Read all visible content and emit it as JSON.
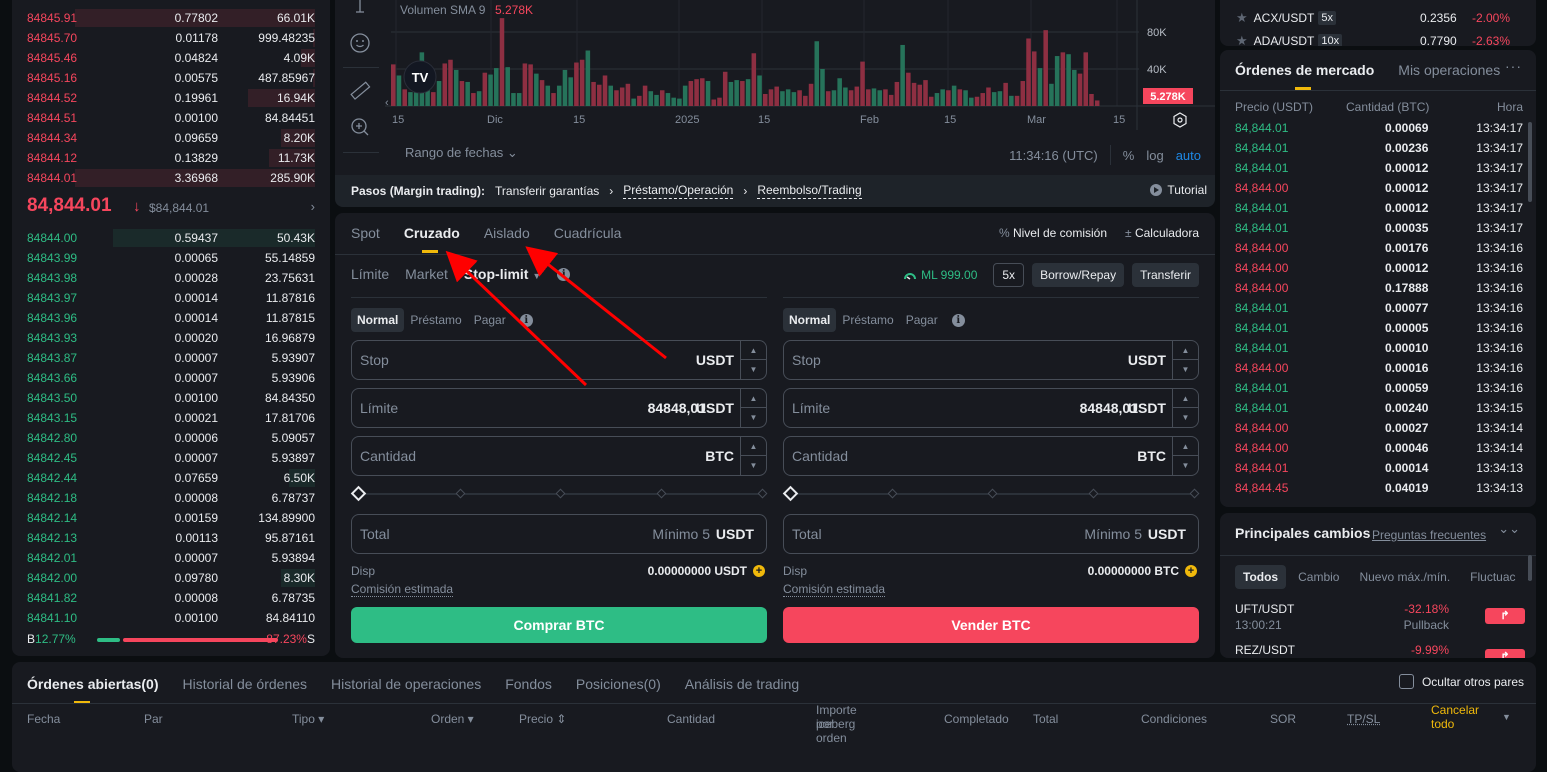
{
  "orderbook": {
    "asks": [
      {
        "price": "84845.91",
        "amount": "0.77802",
        "total": "66.01K",
        "depth": 1.0
      },
      {
        "price": "84845.70",
        "amount": "0.01178",
        "total": "999.48235",
        "depth": 0.01
      },
      {
        "price": "84845.46",
        "amount": "0.04824",
        "total": "4.09K",
        "depth": 0.06
      },
      {
        "price": "84845.16",
        "amount": "0.00575",
        "total": "487.85967",
        "depth": 0.01
      },
      {
        "price": "84844.52",
        "amount": "0.19961",
        "total": "16.94K",
        "depth": 0.28
      },
      {
        "price": "84844.51",
        "amount": "0.00100",
        "total": "84.84451",
        "depth": 0.0
      },
      {
        "price": "84844.34",
        "amount": "0.09659",
        "total": "8.20K",
        "depth": 0.14
      },
      {
        "price": "84844.12",
        "amount": "0.13829",
        "total": "11.73K",
        "depth": 0.19
      },
      {
        "price": "84844.01",
        "amount": "3.36968",
        "total": "285.90K",
        "depth": 1.0
      }
    ],
    "mid_price": "84,844.01",
    "mid_arrow": "↓",
    "mid_usd": "$84,844.01",
    "mid_more": "›",
    "bids": [
      {
        "price": "84844.00",
        "amount": "0.59437",
        "total": "50.43K",
        "depth": 0.84
      },
      {
        "price": "84843.99",
        "amount": "0.00065",
        "total": "55.14859",
        "depth": 0.0
      },
      {
        "price": "84843.98",
        "amount": "0.00028",
        "total": "23.75631",
        "depth": 0.0
      },
      {
        "price": "84843.97",
        "amount": "0.00014",
        "total": "11.87816",
        "depth": 0.0
      },
      {
        "price": "84843.96",
        "amount": "0.00014",
        "total": "11.87815",
        "depth": 0.0
      },
      {
        "price": "84843.93",
        "amount": "0.00020",
        "total": "16.96879",
        "depth": 0.0
      },
      {
        "price": "84843.87",
        "amount": "0.00007",
        "total": "5.93907",
        "depth": 0.0
      },
      {
        "price": "84843.66",
        "amount": "0.00007",
        "total": "5.93906",
        "depth": 0.0
      },
      {
        "price": "84843.50",
        "amount": "0.00100",
        "total": "84.84350",
        "depth": 0.0
      },
      {
        "price": "84843.15",
        "amount": "0.00021",
        "total": "17.81706",
        "depth": 0.0
      },
      {
        "price": "84842.80",
        "amount": "0.00006",
        "total": "5.09057",
        "depth": 0.0
      },
      {
        "price": "84842.45",
        "amount": "0.00007",
        "total": "5.93897",
        "depth": 0.0
      },
      {
        "price": "84842.44",
        "amount": "0.07659",
        "total": "6.50K",
        "depth": 0.11
      },
      {
        "price": "84842.18",
        "amount": "0.00008",
        "total": "6.78737",
        "depth": 0.0
      },
      {
        "price": "84842.14",
        "amount": "0.00159",
        "total": "134.89900",
        "depth": 0.0
      },
      {
        "price": "84842.13",
        "amount": "0.00113",
        "total": "95.87161",
        "depth": 0.0
      },
      {
        "price": "84842.01",
        "amount": "0.00007",
        "total": "5.93894",
        "depth": 0.0
      },
      {
        "price": "84842.00",
        "amount": "0.09780",
        "total": "8.30K",
        "depth": 0.14
      },
      {
        "price": "84841.82",
        "amount": "0.00008",
        "total": "6.78735",
        "depth": 0.0
      },
      {
        "price": "84841.10",
        "amount": "0.00100",
        "total": "84.84110",
        "depth": 0.0
      }
    ],
    "ratio": {
      "b_label": "B",
      "b_pct": "12.77%",
      "s_pct": "87.23%",
      "s_label": "S",
      "buy_fraction": 0.1277
    }
  },
  "chart": {
    "indicator_label": "Volumen SMA 9",
    "indicator_value": "5.278K",
    "y_ticks": [
      "80K",
      "40K"
    ],
    "price_tag": "5.278K",
    "x_ticks": [
      "15",
      "Dic",
      "15",
      "2025",
      "15",
      "Feb",
      "15",
      "Mar",
      "15"
    ],
    "date_range": "Rango de fechas",
    "time": "11:34:16 (UTC)",
    "pct": "%",
    "log": "log",
    "auto": "auto",
    "colors": {
      "up": "#26735a",
      "down": "#8e2f42"
    },
    "volumes_k": [
      [
        45,
        0
      ],
      [
        33,
        1
      ],
      [
        18,
        0
      ],
      [
        15,
        1
      ],
      [
        22,
        1
      ],
      [
        58,
        1
      ],
      [
        37,
        1
      ],
      [
        15,
        0
      ],
      [
        27,
        1
      ],
      [
        46,
        0
      ],
      [
        50,
        0
      ],
      [
        39,
        1
      ],
      [
        27,
        0
      ],
      [
        26,
        1
      ],
      [
        14,
        0
      ],
      [
        16,
        1
      ],
      [
        36,
        0
      ],
      [
        34,
        1
      ],
      [
        41,
        1
      ],
      [
        95,
        0
      ],
      [
        42,
        1
      ],
      [
        14,
        1
      ],
      [
        14,
        1
      ],
      [
        46,
        0
      ],
      [
        45,
        0
      ],
      [
        35,
        1
      ],
      [
        28,
        0
      ],
      [
        22,
        1
      ],
      [
        14,
        0
      ],
      [
        22,
        1
      ],
      [
        39,
        1
      ],
      [
        31,
        1
      ],
      [
        47,
        0
      ],
      [
        50,
        0
      ],
      [
        60,
        1
      ],
      [
        26,
        0
      ],
      [
        23,
        0
      ],
      [
        33,
        0
      ],
      [
        22,
        1
      ],
      [
        17,
        0
      ],
      [
        20,
        0
      ],
      [
        24,
        0
      ],
      [
        8,
        1
      ],
      [
        11,
        0
      ],
      [
        22,
        0
      ],
      [
        16,
        1
      ],
      [
        12,
        1
      ],
      [
        17,
        0
      ],
      [
        14,
        1
      ],
      [
        9,
        1
      ],
      [
        8,
        1
      ],
      [
        22,
        1
      ],
      [
        27,
        0
      ],
      [
        29,
        0
      ],
      [
        30,
        0
      ],
      [
        27,
        1
      ],
      [
        7,
        0
      ],
      [
        9,
        0
      ],
      [
        37,
        0
      ],
      [
        26,
        1
      ],
      [
        28,
        1
      ],
      [
        27,
        0
      ],
      [
        29,
        1
      ],
      [
        57,
        0
      ],
      [
        33,
        1
      ],
      [
        13,
        0
      ],
      [
        18,
        0
      ],
      [
        21,
        0
      ],
      [
        16,
        1
      ],
      [
        18,
        1
      ],
      [
        15,
        1
      ],
      [
        17,
        0
      ],
      [
        11,
        0
      ],
      [
        24,
        0
      ],
      [
        70,
        1
      ],
      [
        40,
        1
      ],
      [
        16,
        0
      ],
      [
        17,
        1
      ],
      [
        30,
        1
      ],
      [
        20,
        1
      ],
      [
        17,
        0
      ],
      [
        21,
        0
      ],
      [
        48,
        0
      ],
      [
        18,
        0
      ],
      [
        19,
        1
      ],
      [
        17,
        1
      ],
      [
        18,
        0
      ],
      [
        12,
        0
      ],
      [
        26,
        0
      ],
      [
        66,
        1
      ],
      [
        36,
        0
      ],
      [
        25,
        0
      ],
      [
        23,
        0
      ],
      [
        28,
        0
      ],
      [
        10,
        0
      ],
      [
        14,
        1
      ],
      [
        18,
        1
      ],
      [
        17,
        0
      ],
      [
        22,
        1
      ],
      [
        18,
        0
      ],
      [
        17,
        1
      ],
      [
        9,
        1
      ],
      [
        10,
        0
      ],
      [
        14,
        0
      ],
      [
        20,
        0
      ],
      [
        15,
        1
      ],
      [
        16,
        1
      ],
      [
        25,
        0
      ],
      [
        11,
        1
      ],
      [
        11,
        0
      ],
      [
        27,
        0
      ],
      [
        73,
        0
      ],
      [
        59,
        0
      ],
      [
        41,
        1
      ],
      [
        82,
        0
      ],
      [
        24,
        1
      ],
      [
        54,
        1
      ],
      [
        58,
        0
      ],
      [
        56,
        1
      ],
      [
        39,
        1
      ],
      [
        35,
        0
      ],
      [
        58,
        0
      ],
      [
        13,
        0
      ],
      [
        6,
        0
      ]
    ]
  },
  "steps": {
    "prefix": "Pasos (Margin trading):",
    "step1": "Transferir garantías",
    "step2": "Préstamo/Operación",
    "step3": "Reembolso/Trading",
    "sep": "›",
    "tutorial": "Tutorial"
  },
  "trade": {
    "tabs": [
      "Spot",
      "Cruzado",
      "Aislado",
      "Cuadrícula"
    ],
    "active_tab": "Cruzado",
    "fee_level": "Nivel de comisión",
    "calculator": "Calculadora",
    "order_types": [
      "Límite",
      "Market",
      "Stop-limit"
    ],
    "active_type": "Stop-limit",
    "margin_level": "ML 999.00",
    "leverage": "5x",
    "borrow_repay": "Borrow/Repay",
    "transfer": "Transferir",
    "modes": [
      "Normal",
      "Préstamo",
      "Pagar"
    ],
    "buy": {
      "stop_label": "Stop",
      "stop_unit": "USDT",
      "limit_label": "Límite",
      "limit_value": "84848,01",
      "limit_unit": "USDT",
      "qty_label": "Cantidad",
      "qty_unit": "BTC",
      "total_label": "Total",
      "total_placeholder": "Mínimo 5",
      "total_unit": "USDT",
      "avail_label": "Disp",
      "avail_value": "0.00000000 USDT",
      "fee_label": "Comisión estimada",
      "action": "Comprar BTC",
      "slider_pct": 0
    },
    "sell": {
      "stop_label": "Stop",
      "stop_unit": "USDT",
      "limit_label": "Límite",
      "limit_value": "84848,01",
      "limit_unit": "USDT",
      "qty_label": "Cantidad",
      "qty_unit": "BTC",
      "total_label": "Total",
      "total_placeholder": "Mínimo 5",
      "total_unit": "USDT",
      "avail_label": "Disp",
      "avail_value": "0.00000000 BTC",
      "fee_label": "Comisión estimada",
      "action": "Vender BTC",
      "slider_pct": 0
    }
  },
  "pairs": [
    {
      "symbol": "ACX/USDT",
      "leverage": "5x",
      "price": "0.2356",
      "change": "-2.00%"
    },
    {
      "symbol": "ADA/USDT",
      "leverage": "10x",
      "price": "0.7790",
      "change": "-2.63%"
    }
  ],
  "market_trades": {
    "tabs": [
      "Órdenes de mercado",
      "Mis operaciones"
    ],
    "more": "···",
    "headers": [
      "Precio (USDT)",
      "Cantidad (BTC)",
      "Hora"
    ],
    "rows": [
      {
        "price": "84,844.01",
        "qty": "0.00069",
        "time": "13:34:17",
        "side": "buy"
      },
      {
        "price": "84,844.01",
        "qty": "0.00236",
        "time": "13:34:17",
        "side": "buy"
      },
      {
        "price": "84,844.01",
        "qty": "0.00012",
        "time": "13:34:17",
        "side": "buy"
      },
      {
        "price": "84,844.00",
        "qty": "0.00012",
        "time": "13:34:17",
        "side": "sell"
      },
      {
        "price": "84,844.01",
        "qty": "0.00012",
        "time": "13:34:17",
        "side": "buy"
      },
      {
        "price": "84,844.01",
        "qty": "0.00035",
        "time": "13:34:17",
        "side": "buy"
      },
      {
        "price": "84,844.00",
        "qty": "0.00176",
        "time": "13:34:16",
        "side": "sell"
      },
      {
        "price": "84,844.00",
        "qty": "0.00012",
        "time": "13:34:16",
        "side": "sell"
      },
      {
        "price": "84,844.00",
        "qty": "0.17888",
        "time": "13:34:16",
        "side": "sell"
      },
      {
        "price": "84,844.01",
        "qty": "0.00077",
        "time": "13:34:16",
        "side": "buy"
      },
      {
        "price": "84,844.01",
        "qty": "0.00005",
        "time": "13:34:16",
        "side": "buy"
      },
      {
        "price": "84,844.01",
        "qty": "0.00010",
        "time": "13:34:16",
        "side": "buy"
      },
      {
        "price": "84,844.00",
        "qty": "0.00016",
        "time": "13:34:16",
        "side": "sell"
      },
      {
        "price": "84,844.01",
        "qty": "0.00059",
        "time": "13:34:16",
        "side": "buy"
      },
      {
        "price": "84,844.01",
        "qty": "0.00240",
        "time": "13:34:15",
        "side": "buy"
      },
      {
        "price": "84,844.00",
        "qty": "0.00027",
        "time": "13:34:14",
        "side": "sell"
      },
      {
        "price": "84,844.00",
        "qty": "0.00046",
        "time": "13:34:14",
        "side": "sell"
      },
      {
        "price": "84,844.01",
        "qty": "0.00014",
        "time": "13:34:13",
        "side": "sell"
      },
      {
        "price": "84,844.45",
        "qty": "0.04019",
        "time": "13:34:13",
        "side": "sell"
      }
    ]
  },
  "movers": {
    "title": "Principales cambios",
    "faq": "Preguntas frecuentes",
    "tabs": [
      "Todos",
      "Cambio",
      "Nuevo máx./mín.",
      "Fluctuac"
    ],
    "rows": [
      {
        "symbol": "UFT/USDT",
        "time": "13:00:21",
        "change": "-32.18%",
        "label": "Pullback"
      },
      {
        "symbol": "REZ/USDT",
        "time": "",
        "change": "-9.99%",
        "label": ""
      }
    ]
  },
  "orders": {
    "tabs": [
      "Órdenes abiertas(0)",
      "Historial de órdenes",
      "Historial de operaciones",
      "Fondos",
      "Posiciones(0)",
      "Análisis de trading"
    ],
    "hide_other": "Ocultar otros pares",
    "columns": [
      "Fecha",
      "Par",
      "Tipo ▾",
      "Orden ▾",
      "Precio ⇕",
      "Cantidad",
      "Importe por orden",
      "iceberg",
      "Completado",
      "Total",
      "Condiciones",
      "SOR",
      "TP/SL",
      "Cancelar",
      "todo"
    ]
  }
}
